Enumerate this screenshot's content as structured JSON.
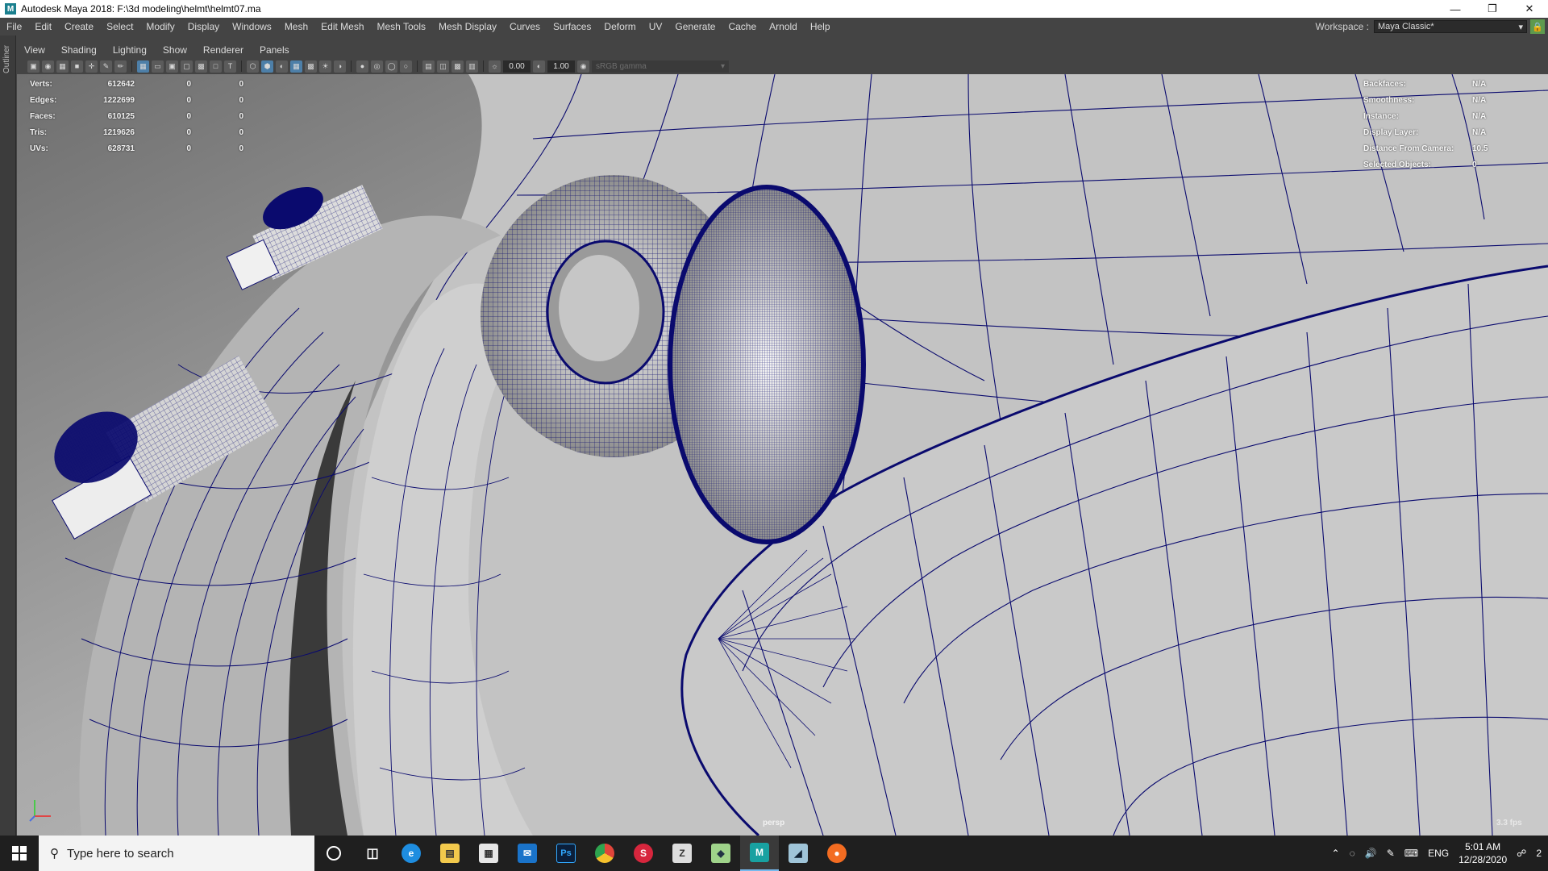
{
  "window": {
    "title": "Autodesk Maya 2018: F:\\3d modeling\\helmt\\helmt07.ma",
    "app_icon": "M",
    "minimize_icon": "minimize-icon",
    "restore_icon": "restore-icon",
    "close_icon": "close-icon"
  },
  "menubar": {
    "items": [
      "File",
      "Edit",
      "Create",
      "Select",
      "Modify",
      "Display",
      "Windows",
      "Mesh",
      "Edit Mesh",
      "Mesh Tools",
      "Mesh Display",
      "Curves",
      "Surfaces",
      "Deform",
      "UV",
      "Generate",
      "Cache",
      "Arnold",
      "Help"
    ],
    "workspace_label": "Workspace :",
    "workspace_value": "Maya Classic*"
  },
  "leftstrip": {
    "label": "Outliner"
  },
  "panel_menu": {
    "items": [
      "View",
      "Shading",
      "Lighting",
      "Show",
      "Renderer",
      "Panels"
    ]
  },
  "toolbar": {
    "field_a": "0.00",
    "field_b": "1.00",
    "color_space": "sRGB gamma"
  },
  "hud_stats": {
    "rows": [
      {
        "label": "Verts:",
        "v1": "612642",
        "v2": "0",
        "v3": "0"
      },
      {
        "label": "Edges:",
        "v1": "1222699",
        "v2": "0",
        "v3": "0"
      },
      {
        "label": "Faces:",
        "v1": "610125",
        "v2": "0",
        "v3": "0"
      },
      {
        "label": "Tris:",
        "v1": "1219626",
        "v2": "0",
        "v3": "0"
      },
      {
        "label": "UVs:",
        "v1": "628731",
        "v2": "0",
        "v3": "0"
      }
    ]
  },
  "hud_info": {
    "rows": [
      {
        "label": "Backfaces:",
        "value": "N/A"
      },
      {
        "label": "Smoothness:",
        "value": "N/A"
      },
      {
        "label": "Instance:",
        "value": "N/A"
      },
      {
        "label": "Display Layer:",
        "value": "N/A"
      },
      {
        "label": "Distance From Camera:",
        "value": "10.5"
      },
      {
        "label": "Selected Objects:",
        "value": "0"
      }
    ]
  },
  "viewport": {
    "camera": "persp",
    "fps": "3.3 fps",
    "wire_color": "#0a0a6e"
  },
  "taskbar": {
    "search_placeholder": "Type here to search",
    "apps": [
      "cortana-icon",
      "task-view-icon",
      "edge-icon",
      "file-explorer-icon",
      "store-icon",
      "mail-icon",
      "photoshop-icon",
      "chrome-icon",
      "substance-icon",
      "zbrush-icon",
      "marmoset-icon",
      "maya-icon",
      "blender-icon",
      "origin-icon"
    ],
    "lang": "ENG",
    "time": "5:01 AM",
    "date": "12/28/2020",
    "notifications": "2"
  }
}
